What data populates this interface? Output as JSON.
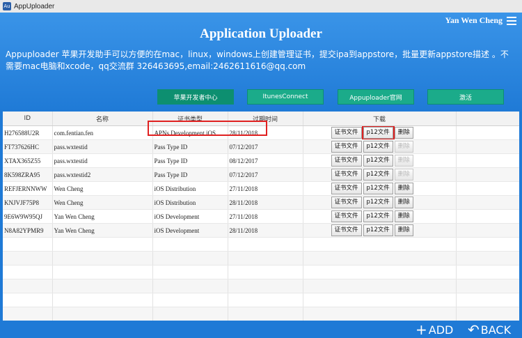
{
  "window": {
    "title": "AppUploader"
  },
  "header": {
    "user": "Yan Wen Cheng",
    "title": "Application Uploader",
    "description": "Appuploader 苹果开发助手可以方便的在mac，linux，windows上创建管理证书，提交ipa到appstore，批量更新appstore描述 。不需要mac电脑和xcode，qq交流群 326463695,email:2462611616@qq.com"
  },
  "nav": [
    {
      "label": "苹果开发者中心"
    },
    {
      "label": "ItunesConnect"
    },
    {
      "label": "Appuploader官网"
    },
    {
      "label": "激活"
    }
  ],
  "table": {
    "columns": [
      "ID",
      "名称",
      "证书类型",
      "过期时间",
      "下载"
    ],
    "buttons": {
      "cert": "证书文件",
      "p12": "p12文件",
      "delete": "删除"
    },
    "rows": [
      {
        "id": "H276588U2R",
        "name": "com.fentian.fen",
        "type": "APNs Development iOS",
        "expiry": "28/11/2018",
        "delete_disabled": false
      },
      {
        "id": "FT737626HC",
        "name": "pass.wxtestid",
        "type": "Pass Type ID",
        "expiry": "07/12/2017",
        "delete_disabled": true
      },
      {
        "id": "XTAX365Z55",
        "name": "pass.wxtestid",
        "type": "Pass Type ID",
        "expiry": "08/12/2017",
        "delete_disabled": true
      },
      {
        "id": "8K598ZRA95",
        "name": "pass.wxtestid2",
        "type": "Pass Type ID",
        "expiry": "07/12/2017",
        "delete_disabled": true
      },
      {
        "id": "REFJERNNWW",
        "name": "Wen Cheng",
        "type": "iOS Distribution",
        "expiry": "27/11/2018",
        "delete_disabled": false
      },
      {
        "id": "KNJVJF75P8",
        "name": "Wen Cheng",
        "type": "iOS Distribution",
        "expiry": "28/11/2018",
        "delete_disabled": false
      },
      {
        "id": "9E6W9W95QJ",
        "name": "Yan Wen Cheng",
        "type": "iOS Development",
        "expiry": "27/11/2018",
        "delete_disabled": false
      },
      {
        "id": "N8A82YPMR9",
        "name": "Yan Wen Cheng",
        "type": "iOS Development",
        "expiry": "28/11/2018",
        "delete_disabled": false
      }
    ]
  },
  "footer": {
    "add": "ADD",
    "back": "BACK"
  },
  "colors": {
    "accent": "#1f7ad6",
    "nav_button": "#1bab8a",
    "highlight": "#e02020"
  }
}
